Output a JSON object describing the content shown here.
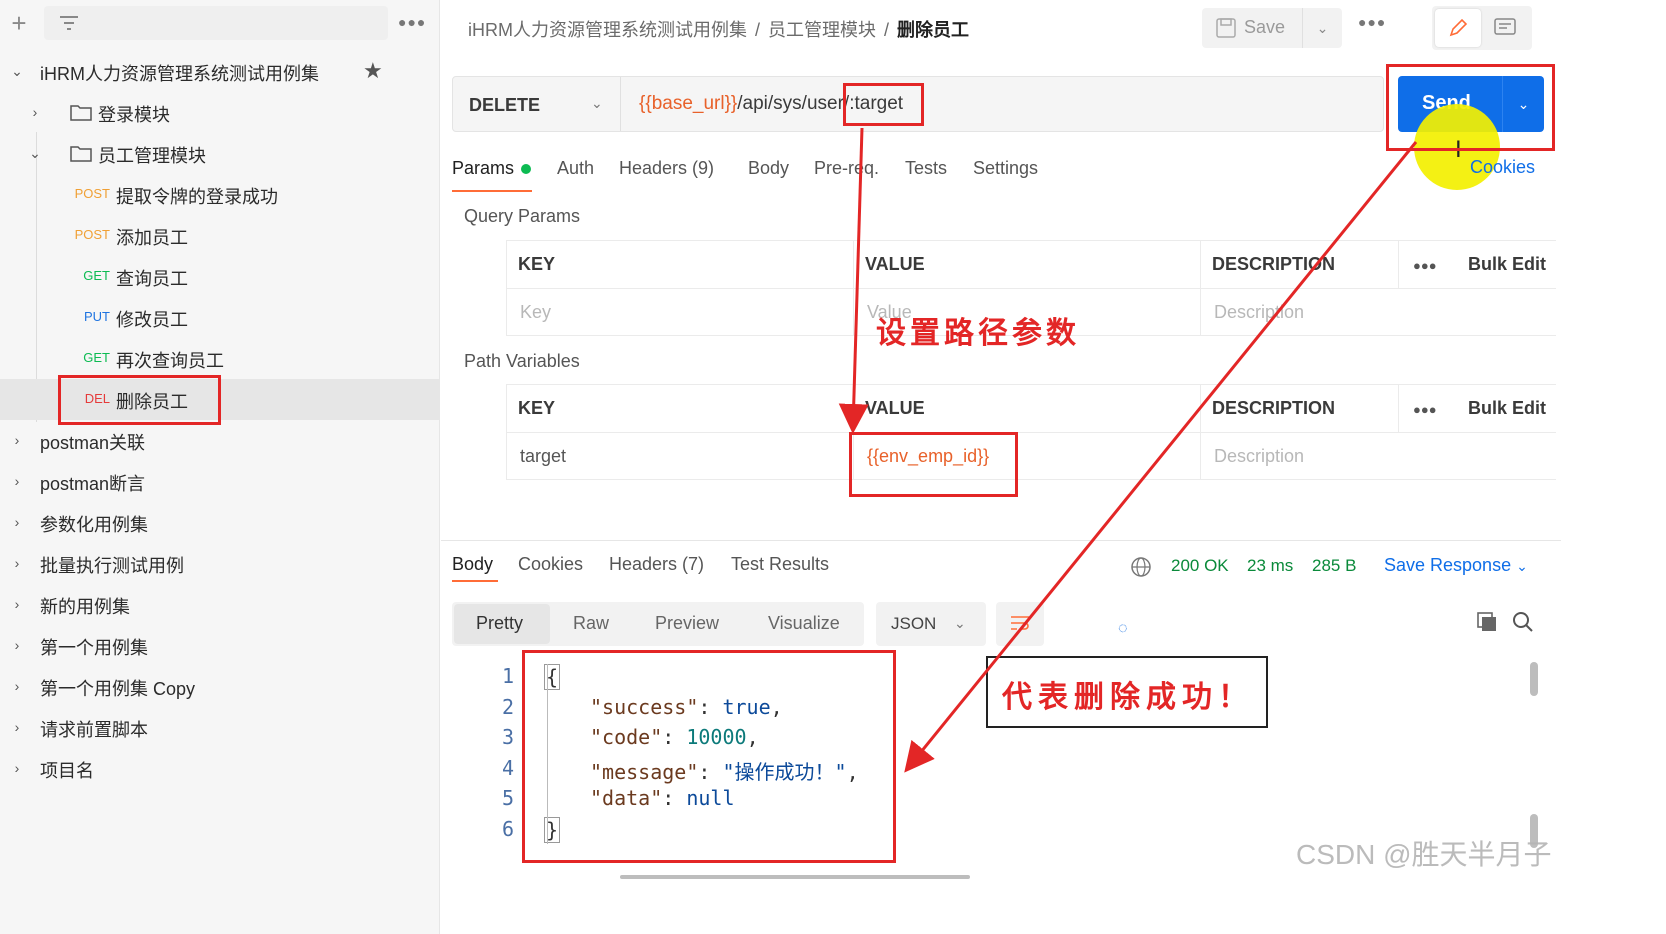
{
  "sidebar": {
    "collection_title": "iHRM人力资源管理系统测试用例集",
    "folders": [
      {
        "label": "登录模块",
        "expanded": false
      },
      {
        "label": "员工管理模块",
        "expanded": true
      }
    ],
    "requests": [
      {
        "method": "POST",
        "label": "提取令牌的登录成功",
        "color": "#f0a035"
      },
      {
        "method": "POST",
        "label": "添加员工",
        "color": "#f0a035"
      },
      {
        "method": "GET",
        "label": "查询员工",
        "color": "#0cbb52"
      },
      {
        "method": "PUT",
        "label": "修改员工",
        "color": "#1f74e0"
      },
      {
        "method": "GET",
        "label": "再次查询员工",
        "color": "#0cbb52"
      },
      {
        "method": "DEL",
        "label": "删除员工",
        "color": "#e53b3b"
      }
    ],
    "collections": [
      "postman关联",
      "postman断言",
      "参数化用例集",
      "批量执行测试用例",
      "新的用例集",
      "第一个用例集",
      "第一个用例集 Copy",
      "请求前置脚本",
      "项目名"
    ]
  },
  "breadcrumb": {
    "collection": "iHRM人力资源管理系统测试用例集",
    "folder": "员工管理模块",
    "request": "删除员工"
  },
  "toolbar": {
    "save_label": "Save"
  },
  "request": {
    "method": "DELETE",
    "url_var": "{{base_url}}",
    "url_path": "/api/sys/user/",
    "url_param": ":target",
    "send_label": "Send",
    "cookies_label": "Cookies"
  },
  "request_tabs": {
    "params": "Params",
    "auth": "Auth",
    "headers": "Headers (9)",
    "body": "Body",
    "prereq": "Pre-req.",
    "tests": "Tests",
    "settings": "Settings"
  },
  "query_params": {
    "title": "Query Params",
    "col_key": "KEY",
    "col_value": "VALUE",
    "col_desc": "DESCRIPTION",
    "bulk_edit": "Bulk Edit",
    "ph_key": "Key",
    "ph_value": "Value",
    "ph_desc": "Description"
  },
  "path_variables": {
    "title": "Path Variables",
    "col_key": "KEY",
    "col_value": "VALUE",
    "col_desc": "DESCRIPTION",
    "bulk_edit": "Bulk Edit",
    "row_key": "target",
    "row_value": "{{env_emp_id}}",
    "ph_desc": "Description"
  },
  "response": {
    "tabs": {
      "body": "Body",
      "cookies": "Cookies",
      "headers": "Headers (7)",
      "tests": "Test Results"
    },
    "status": "200 OK",
    "time": "23 ms",
    "size": "285 B",
    "save_response": "Save Response",
    "views": {
      "pretty": "Pretty",
      "raw": "Raw",
      "preview": "Preview",
      "visualize": "Visualize"
    },
    "format": "JSON",
    "lines": [
      "1",
      "2",
      "3",
      "4",
      "5",
      "6"
    ],
    "json": {
      "open": "{",
      "k_success": "\"success\"",
      "v_success": "true",
      "k_code": "\"code\"",
      "v_code": "10000",
      "k_message": "\"message\"",
      "v_message": "\"操作成功！\"",
      "k_data": "\"data\"",
      "v_data": "null",
      "close": "}"
    }
  },
  "annotations": {
    "path_param_note": "设置路径参数",
    "success_note": "代表删除成功！",
    "color": "#e32626"
  },
  "watermark": "CSDN @胜天半月子"
}
